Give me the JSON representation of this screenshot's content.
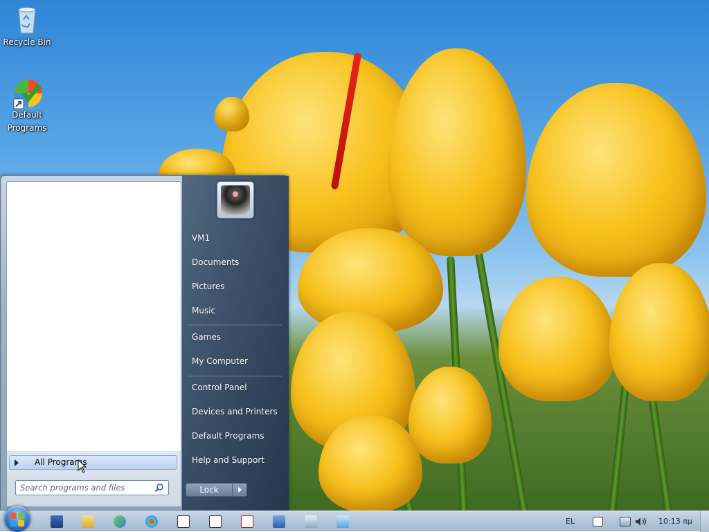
{
  "desktop": {
    "icons": [
      {
        "label": "Recycle Bin",
        "icon": "recycle-bin-icon"
      },
      {
        "label": "Default\nPrograms",
        "label_line1": "Default",
        "label_line2": "Programs",
        "icon": "default-programs-icon"
      }
    ]
  },
  "start_menu": {
    "all_programs": "All Programs",
    "search_placeholder": "Search programs and files",
    "user": "VM1",
    "right_items": [
      "Documents",
      "Pictures",
      "Music",
      "Games",
      "My Computer",
      "Control Panel",
      "Devices and Printers",
      "Default Programs",
      "Help and Support"
    ],
    "lock_label": "Lock"
  },
  "taskbar": {
    "pinned": [
      "powershell-icon",
      "explorer-icon",
      "network-icon",
      "paint-icon",
      "calculator-icon",
      "media-icon",
      "solitaire-icon",
      "remote-desktop-icon",
      "calc2-icon",
      "notepad-icon"
    ],
    "language": "EL",
    "clock": "10:13 πμ"
  },
  "colors": {
    "accent": "#2c76c8",
    "taskbar": "#b3c6da",
    "start_right_pane": "#4b6279"
  }
}
